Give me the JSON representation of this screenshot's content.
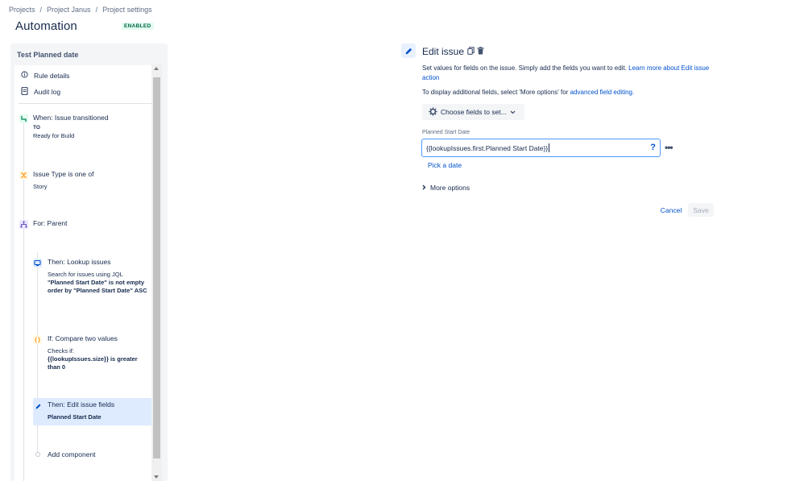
{
  "breadcrumb": {
    "items": [
      "Projects",
      "Project Janus",
      "Project settings"
    ],
    "sep": "/"
  },
  "header": {
    "title": "Automation",
    "status": "ENABLED"
  },
  "rule": {
    "name": "Test Planned date",
    "nav": [
      {
        "label": "Rule details",
        "icon": "info-icon"
      },
      {
        "label": "Audit log",
        "icon": "document-icon"
      }
    ],
    "components": {
      "trigger": {
        "title": "When: Issue transitioned",
        "to_label": "TO",
        "to_value": "Ready for Build"
      },
      "condition": {
        "title": "Issue Type is one of",
        "value": "Story"
      },
      "branch": {
        "title": "For: Parent"
      },
      "lookup": {
        "title": "Then: Lookup issues",
        "desc_prefix": "Search for issues using JQL",
        "desc_bold": "\"Planned Start Date\" is not empty order by \"Planned Start Date\" ASC"
      },
      "compare": {
        "title": "If: Compare two values",
        "desc_prefix": "Checks if:",
        "desc_bold": "{{lookupIssues.size}} is greater than 0"
      },
      "edit": {
        "title": "Then: Edit issue fields",
        "value": "Planned Start Date"
      },
      "add": {
        "label": "Add component"
      }
    }
  },
  "editor": {
    "title": "Edit issue",
    "description": "Set values for fields on the issue. Simply add the fields you want to edit.",
    "learn_more": "Learn more about Edit issue action",
    "extra_prefix": "To display additional fields, select 'More options' for",
    "extra_link": "advanced field editing.",
    "choose_fields": "Choose fields to set...",
    "field_label": "Planned Start Date",
    "field_value": "{{lookupIssues.first.Planned Start Date}}",
    "help": "?",
    "more": "•••",
    "pick_date": "Pick a date",
    "more_options": "More options",
    "cancel": "Cancel",
    "save": "Save"
  },
  "colors": {
    "accent": "#0052cc",
    "selected": "#deebff",
    "enabled_bg": "#e3fcef",
    "enabled_text": "#006644"
  }
}
